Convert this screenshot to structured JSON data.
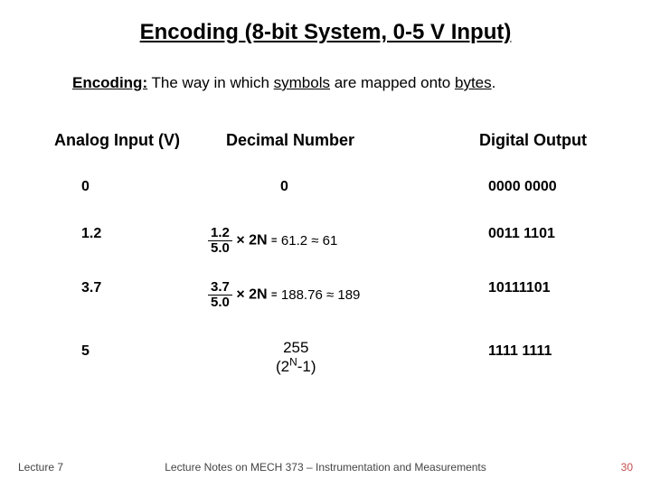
{
  "title": "Encoding (8-bit System, 0-5 V Input)",
  "definition": {
    "label": "Encoding:",
    "pre": " The way in which ",
    "term1": "symbols",
    "mid": " are mapped onto ",
    "term2": "bytes",
    "post": "."
  },
  "headers": {
    "col1": "Analog Input (V)",
    "col2": "Decimal Number",
    "col3": "Digital Output"
  },
  "rows": [
    {
      "analog": "0",
      "decimal_plain": "0",
      "digital": "0000 0000"
    },
    {
      "analog": "1.2",
      "frac_num": "1.2",
      "frac_den": "5.0",
      "times": "×",
      "two_n": "2N",
      "eq": "=",
      "calc": "61.2 ≈ 61",
      "digital": "0011 1101"
    },
    {
      "analog": "3.7",
      "frac_num": "3.7",
      "frac_den": "5.0",
      "times": "×",
      "two_n": "2N",
      "eq": "=",
      "calc": "188.76 ≈ 189",
      "digital": "10111101"
    },
    {
      "analog": "5",
      "decimal_plain": "",
      "digital": "1111 1111"
    }
  ],
  "note255": {
    "line1": "255",
    "line2_pre": "(2",
    "line2_sup": "N",
    "line2_post": "-1)"
  },
  "footer": {
    "left": "Lecture 7",
    "center": "Lecture Notes on MECH 373 – Instrumentation and Measurements",
    "right": "30"
  }
}
